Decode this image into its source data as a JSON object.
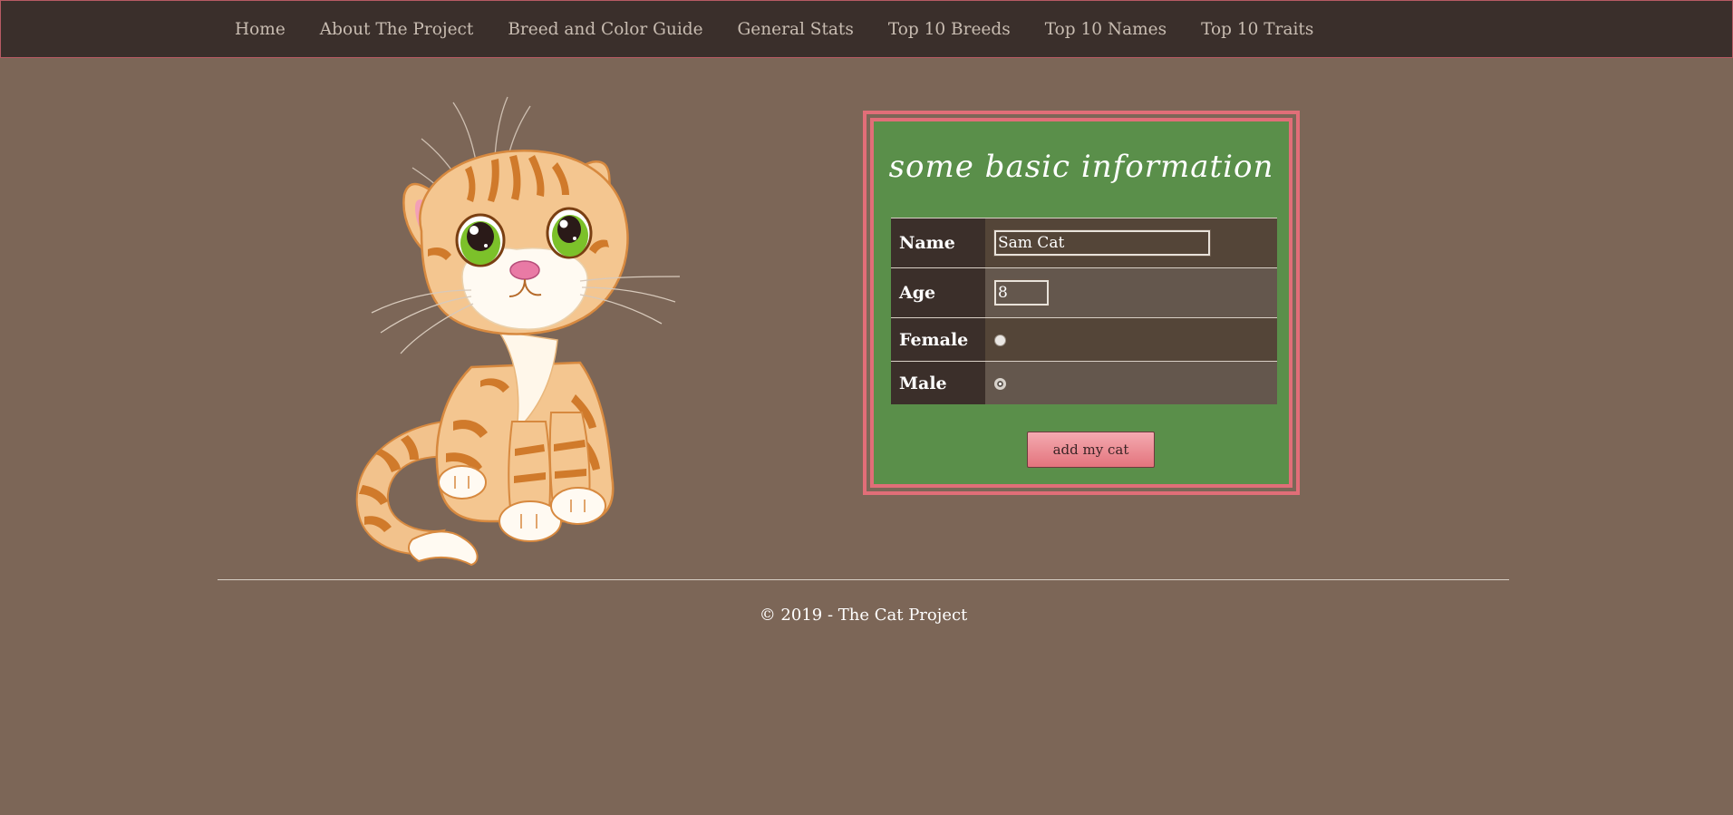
{
  "nav": {
    "items": [
      {
        "label": "Home"
      },
      {
        "label": "About The Project"
      },
      {
        "label": "Breed and Color Guide"
      },
      {
        "label": "General Stats"
      },
      {
        "label": "Top 10 Breeds"
      },
      {
        "label": "Top 10 Names"
      },
      {
        "label": "Top 10 Traits"
      }
    ]
  },
  "hero": {
    "image_icon": "orange-tabby-kitten-illustration"
  },
  "form": {
    "title": "some basic information",
    "name_label": "Name",
    "name_value": "Sam Cat",
    "age_label": "Age",
    "age_value": "8",
    "female_label": "Female",
    "female_checked": false,
    "male_label": "Male",
    "male_checked": true,
    "submit_label": "add my cat"
  },
  "footer": {
    "text": "© 2019 - The Cat Project"
  },
  "colors": {
    "page_bg": "#7c6657",
    "nav_bg": "#3a2f2b",
    "panel_green": "#5a8f4a",
    "panel_border_pink": "#e16e78",
    "button_pink": "#ef9aa2"
  }
}
